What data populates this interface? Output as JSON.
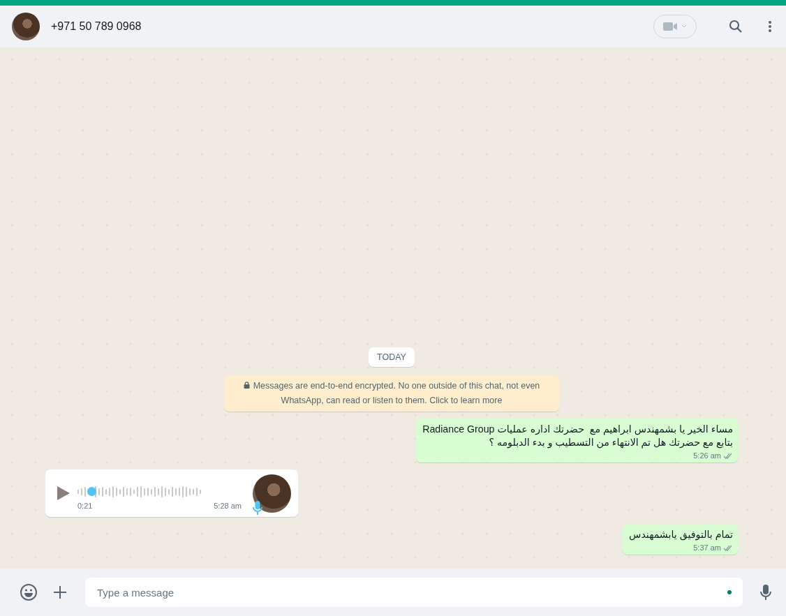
{
  "header": {
    "contact": "+971 50 789 0968"
  },
  "date_chip": "TODAY",
  "encryption_notice": "Messages are end-to-end encrypted. No one outside of this chat, not even WhatsApp, can read or listen to them. Click to learn more",
  "messages": [
    {
      "kind": "text",
      "outgoing": true,
      "lines": [
        "مساء الخير يا بشمهندس ابراهيم مع  حضرتك اداره عمليات Radiance Group",
        "بتابع مع حضرتك هل تم الانتهاء من التسطيب و بدء الدبلومه ؟"
      ],
      "time": "5:26 am",
      "read": false
    },
    {
      "kind": "voice",
      "outgoing": false,
      "duration": "0:21",
      "time": "5:28 am",
      "level": 0.08
    },
    {
      "kind": "text",
      "outgoing": true,
      "lines": [
        "تمام بالتوفيق يابشمهندس"
      ],
      "time": "5:37 am",
      "read": false
    }
  ],
  "composer": {
    "placeholder": "Type a message"
  }
}
